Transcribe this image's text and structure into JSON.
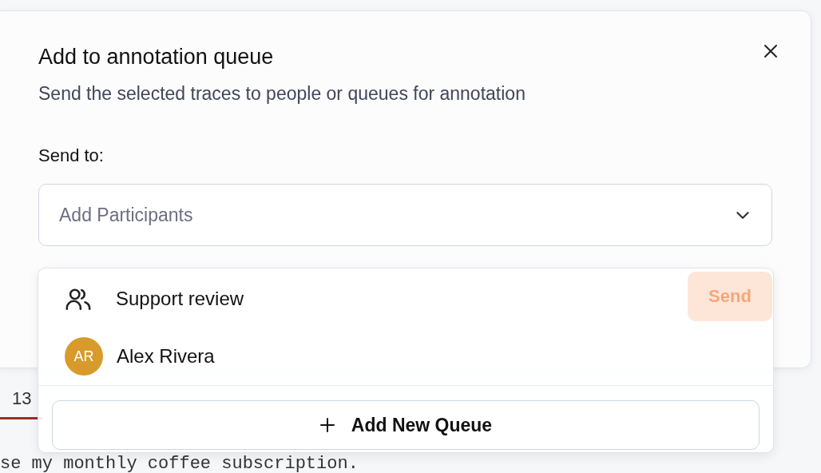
{
  "background": {
    "tab_label": "13",
    "message": "se my monthly coffee subscription."
  },
  "dialog": {
    "title": "Add to annotation queue",
    "description": "Send the selected traces to people or queues for annotation",
    "send_to_label": "Send to:",
    "participants_field": {
      "placeholder": "Add Participants"
    },
    "send_button": {
      "label": "Send",
      "disabled": true
    }
  },
  "dropdown": {
    "options": [
      {
        "kind": "queue",
        "label": "Support review"
      },
      {
        "kind": "person",
        "label": "Alex Rivera",
        "initials": "AR",
        "color": "#d89b2b"
      }
    ],
    "add_button": "Add New Queue"
  }
}
